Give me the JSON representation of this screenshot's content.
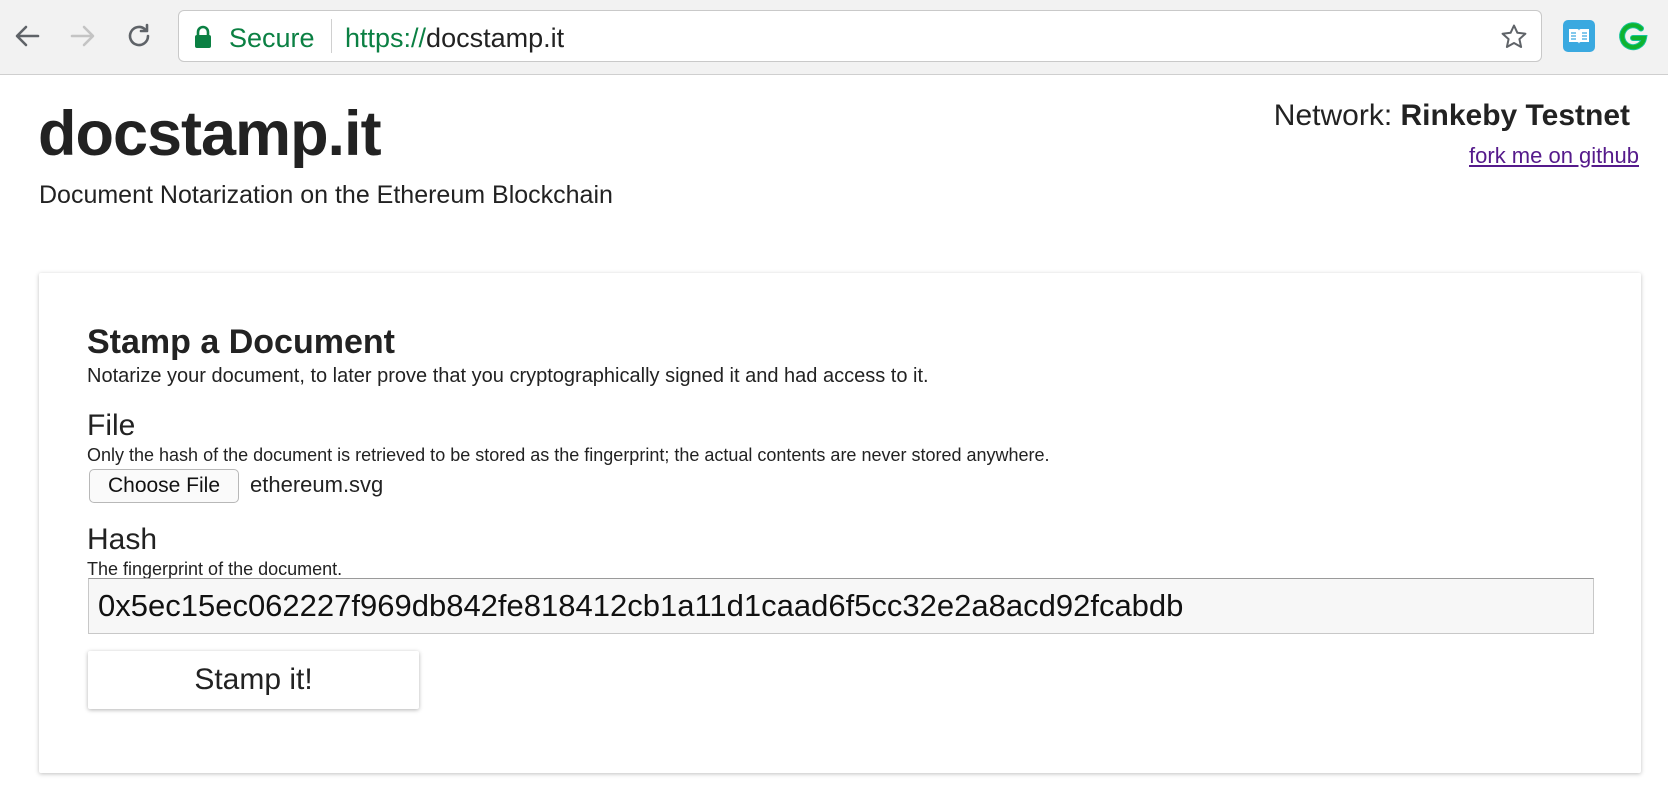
{
  "browser": {
    "secure_label": "Secure",
    "url_scheme": "https://",
    "url_host": "docstamp.it",
    "secure_color": "#0b8043"
  },
  "header": {
    "title": "docstamp.it",
    "subtitle": "Document Notarization on the Ethereum Blockchain",
    "network_label": "Network:",
    "network_value": "Rinkeby Testnet",
    "github_link": "fork me on github"
  },
  "stamp_form": {
    "title": "Stamp a Document",
    "description": "Notarize your document, to later prove that you cryptographically signed it and had access to it.",
    "file_label": "File",
    "file_help": "Only the hash of the document is retrieved to be stored as the fingerprint; the actual contents are never stored anywhere.",
    "choose_file_label": "Choose File",
    "file_name": "ethereum.svg",
    "hash_label": "Hash",
    "hash_help": "The fingerprint of the document.",
    "hash_value": "0x5ec15ec062227f969db842fe818412cb1a11d1caad6f5cc32e2a8acd92fcabdb",
    "submit_label": "Stamp it!"
  }
}
